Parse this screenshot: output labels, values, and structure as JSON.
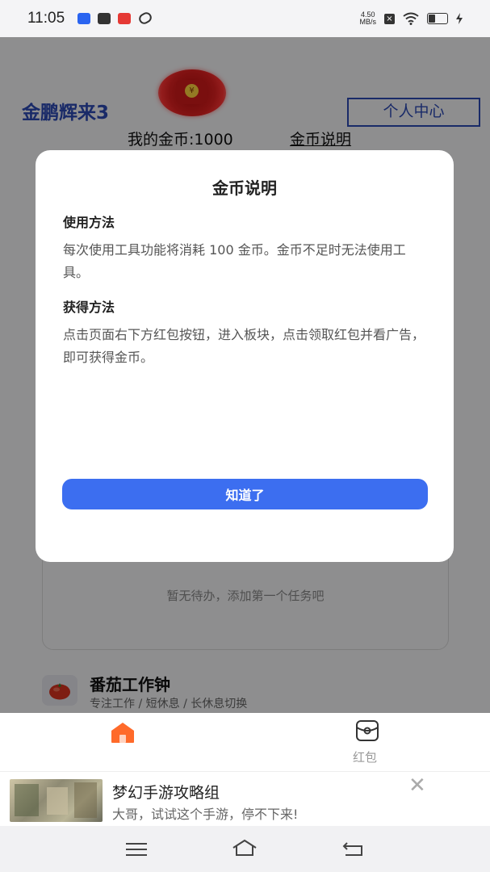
{
  "status_bar": {
    "time": "11:05",
    "net_speed_value": "4.50",
    "net_speed_unit": "MB/s"
  },
  "header": {
    "app_title": "金鹏辉来3",
    "personal_center_label": "个人中心",
    "coins_label": "我的金币:1000",
    "coins_info_link": "金币说明",
    "red_packet_symbol": "¥"
  },
  "dialog": {
    "title": "金币说明",
    "sections": [
      {
        "heading": "使用方法",
        "body": "每次使用工具功能将消耗 100 金币。金币不足时无法使用工具。"
      },
      {
        "heading": "获得方法",
        "body": "点击页面右下方红包按钮，进入板块，点击领取红包并看广告，即可获得金币。"
      }
    ],
    "confirm_label": "知道了"
  },
  "todo": {
    "empty_text": "暂无待办，添加第一个任务吧"
  },
  "pomodoro": {
    "title": "番茄工作钟",
    "subtitle": "专注工作 / 短休息 / 长休息切换"
  },
  "bottom_nav": {
    "items": [
      {
        "label": "",
        "icon": "home-icon",
        "active": true
      },
      {
        "label": "红包",
        "icon": "red-packet-icon",
        "active": false
      }
    ]
  },
  "ad": {
    "title": "梦幻手游攻略组",
    "description": "大哥，试试这个手游，停不下来!",
    "close_symbol": "✕"
  },
  "colors": {
    "accent": "#3c6ef0",
    "title_blue": "#2c49b4",
    "home_orange": "#ff6a2a"
  }
}
